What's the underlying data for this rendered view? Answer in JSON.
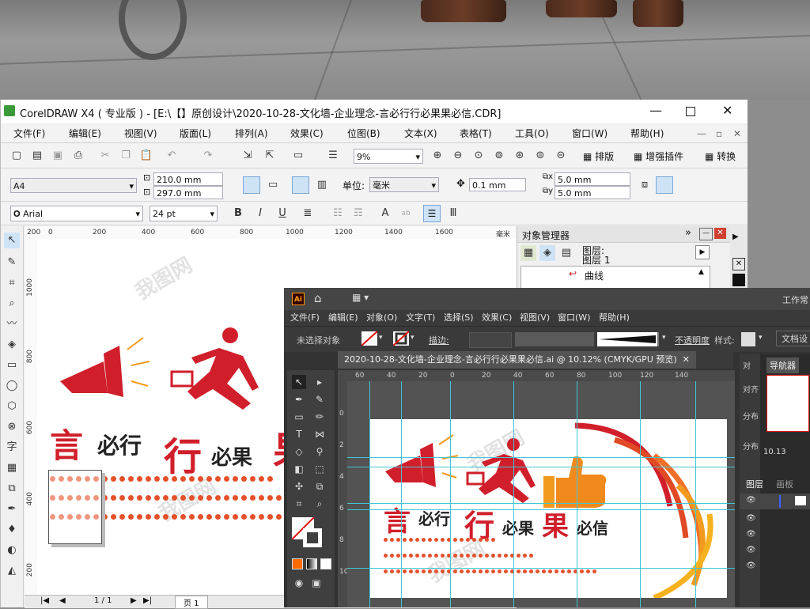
{
  "corel": {
    "title": "CorelDRAW X4 ( 专业版 ) - [E:\\【】原创设计\\2020-10-28-文化墙-企业理念-言必行行必果果必信.CDR]",
    "menu": [
      "文件(F)",
      "编辑(E)",
      "视图(V)",
      "版面(L)",
      "排列(A)",
      "效果(C)",
      "位图(B)",
      "文本(X)",
      "表格(T)",
      "工具(O)",
      "窗口(W)",
      "帮助(H)"
    ],
    "zoom": "9%",
    "toolbar_right": [
      "排版",
      "增强插件",
      "转换"
    ],
    "paper_size": "A4",
    "width": "210.0 mm",
    "height": "297.0 mm",
    "units_label": "单位:",
    "units": "毫米",
    "nudge": "0.1 mm",
    "dup_x": "5.0 mm",
    "dup_y": "5.0 mm",
    "font_name": "Arial",
    "font_size": "24 pt",
    "ruler_top": [
      "200",
      "0",
      "200",
      "400",
      "600",
      "800",
      "1000",
      "1200",
      "1400",
      "1600"
    ],
    "ruler_unit": "毫米",
    "ruler_left": [
      "1000",
      "800",
      "600",
      "400",
      "200"
    ],
    "object_manager": {
      "title": "对象管理器",
      "layer_label": "图层:",
      "layer_name": "图层 1",
      "item": "曲线"
    },
    "page_nav": {
      "pages": "1 / 1",
      "tab": "页 1"
    },
    "artwork": {
      "text1": "言",
      "text2": "必行",
      "text3": "行",
      "text4": "必果",
      "text5": "果"
    }
  },
  "ai": {
    "logo": "Ai",
    "workspace": "工作常",
    "menu": [
      "文件(F)",
      "编辑(E)",
      "对象(O)",
      "文字(T)",
      "选择(S)",
      "效果(C)",
      "视图(V)",
      "窗口(W)",
      "帮助(H)"
    ],
    "control": {
      "no_selection": "未选择对象",
      "stroke": "描边:",
      "opacity": "不透明度",
      "style": "样式:",
      "doc_setup": "文档设"
    },
    "tab": "2020-10-28-文化墙-企业理念-言必行行必果果必信.ai @ 10.12% (CMYK/GPU 预览)",
    "ruler_top": [
      "60",
      "40",
      "20",
      "0",
      "20",
      "40",
      "60",
      "80",
      "100",
      "120",
      "140"
    ],
    "ruler_left": [
      "0",
      "2",
      "4",
      "6",
      "8",
      "10"
    ],
    "artwork": {
      "t1": "言",
      "t2": "必行",
      "t3": "行",
      "t4": "必果",
      "t5": "果",
      "t6": "必信"
    },
    "panels": {
      "navigator": "导航器",
      "align_short": "对",
      "align1": "对齐",
      "align2": "分布",
      "align3": "分布",
      "zoom_val": "10.13",
      "layers": "图层",
      "artboards": "画板"
    }
  },
  "watermark": "我图网",
  "colors": {
    "brand_red": "#d01f2b",
    "orange": "#f29a1e",
    "dot": "#e5502a",
    "guide": "#3fc6d6"
  }
}
